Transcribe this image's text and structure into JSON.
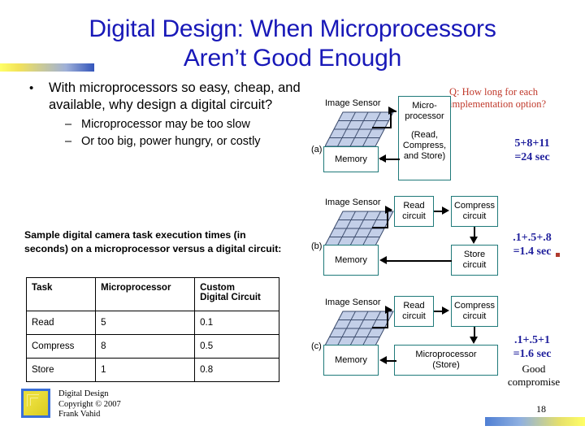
{
  "slide": {
    "title": "Digital Design: When Microprocessors Aren’t Good Enough",
    "title_line1": "Digital Design: When Microprocessors",
    "title_line2": "Aren’t Good Enough",
    "page_number": "18"
  },
  "bullets": {
    "main": "With microprocessors so easy, cheap, and available, why design a digital circuit?",
    "bullet_char": "•",
    "dash_char": "–",
    "sub": [
      "Microprocessor may be too slow",
      "Or too big, power hungry, or costly"
    ]
  },
  "sample_caption": "Sample digital camera task execution times (in seconds) on a microprocessor versus a digital circuit:",
  "table": {
    "headers": [
      "Task",
      "Microprocessor",
      "Custom Digital Circuit"
    ],
    "header_custom_line1": "Custom",
    "header_custom_line2": "Digital Circuit",
    "rows": [
      {
        "task": "Read",
        "micro": "5",
        "custom": "0.1"
      },
      {
        "task": "Compress",
        "micro": "8",
        "custom": "0.5"
      },
      {
        "task": "Store",
        "micro": "1",
        "custom": "0.8"
      }
    ]
  },
  "question": {
    "line1": "Q: How long for each",
    "line2": "implementation option?",
    "color": "#c0392b"
  },
  "annotations": [
    {
      "expr": "5+8+11",
      "result": "=24 sec"
    },
    {
      "expr": ".1+.5+.8",
      "result": "=1.4 sec"
    },
    {
      "expr": ".1+.5+1",
      "result": "=1.6 sec"
    }
  ],
  "good_compromise": {
    "line1": "Good",
    "line2": "compromise"
  },
  "diagrams": [
    {
      "tag": "(a)",
      "sensor_label": "Image Sensor",
      "memory_label": "Memory",
      "processor_line1": "Micro-",
      "processor_line2": "processor",
      "processor_line3": "(Read,",
      "processor_line4": "Compress,",
      "processor_line5": "and Store)"
    },
    {
      "tag": "(b)",
      "sensor_label": "Image Sensor",
      "memory_label": "Memory",
      "read_line1": "Read",
      "read_line2": "circuit",
      "compress_line1": "Compress",
      "compress_line2": "circuit",
      "store_line1": "Store",
      "store_line2": "circuit"
    },
    {
      "tag": "(c)",
      "sensor_label": "Image Sensor",
      "memory_label": "Memory",
      "read_line1": "Read",
      "read_line2": "circuit",
      "compress_line1": "Compress",
      "compress_line2": "circuit",
      "proc_line1": "Microprocessor",
      "proc_line2": "(Store)"
    }
  ],
  "footer": {
    "line1": "Digital Design",
    "line2": "Copyright © 2007",
    "line3": "Frank Vahid"
  },
  "colors": {
    "title": "#1818b8",
    "box_border": "#1f7a7a",
    "sensor_fill": "#c3cfe8",
    "annotation": "#1f1f9c",
    "question": "#c0392b"
  }
}
